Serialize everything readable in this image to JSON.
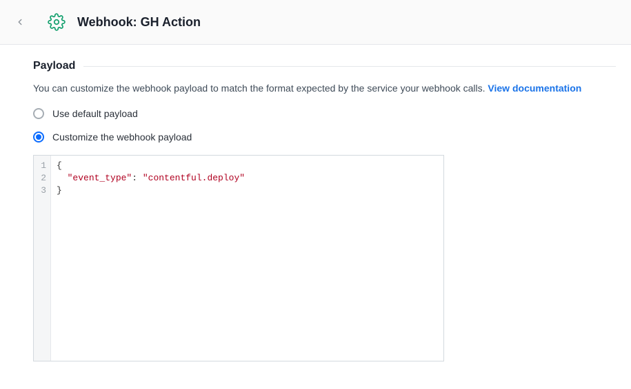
{
  "header": {
    "title": "Webhook: GH Action"
  },
  "payload": {
    "section_title": "Payload",
    "description_prefix": "You can customize the webhook payload to match the format expected by the service your webhook calls. ",
    "doc_link_label": "View documentation",
    "radio_default_label": "Use default payload",
    "radio_custom_label": "Customize the webhook payload"
  },
  "editor": {
    "line_numbers": [
      "1",
      "2",
      "3"
    ],
    "code": {
      "open_brace": "{",
      "indent": "  ",
      "key_quoted": "\"event_type\"",
      "colon_space": ": ",
      "value_quoted": "\"contentful.deploy\"",
      "close_brace": "}"
    }
  }
}
